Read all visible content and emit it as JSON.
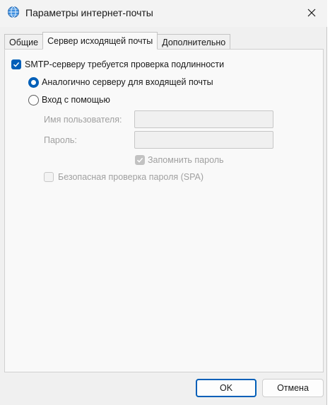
{
  "window": {
    "title": "Параметры интернет-почты",
    "icon": "globe-mail-icon",
    "close_icon": "close-icon"
  },
  "tabs": [
    {
      "label": "Общие",
      "active": false
    },
    {
      "label": "Сервер исходящей почты",
      "active": true
    },
    {
      "label": "Дополнительно",
      "active": false
    }
  ],
  "smtp": {
    "auth_required_label": "SMTP-серверу требуется проверка подлинности",
    "auth_required_checked": true,
    "same_as_incoming_label": "Аналогично серверу для входящей почты",
    "same_as_incoming_selected": true,
    "login_with_label": "Вход с помощью",
    "login_with_selected": false,
    "username_label": "Имя пользователя:",
    "username_value": "",
    "password_label": "Пароль:",
    "password_value": "",
    "remember_password_label": "Запомнить пароль",
    "remember_password_checked": true,
    "spa_label": "Безопасная проверка пароля (SPA)",
    "spa_checked": false
  },
  "buttons": {
    "ok": "OK",
    "cancel": "Отмена"
  },
  "colors": {
    "accent": "#005fb8",
    "disabled_text": "#a0a0a0"
  }
}
